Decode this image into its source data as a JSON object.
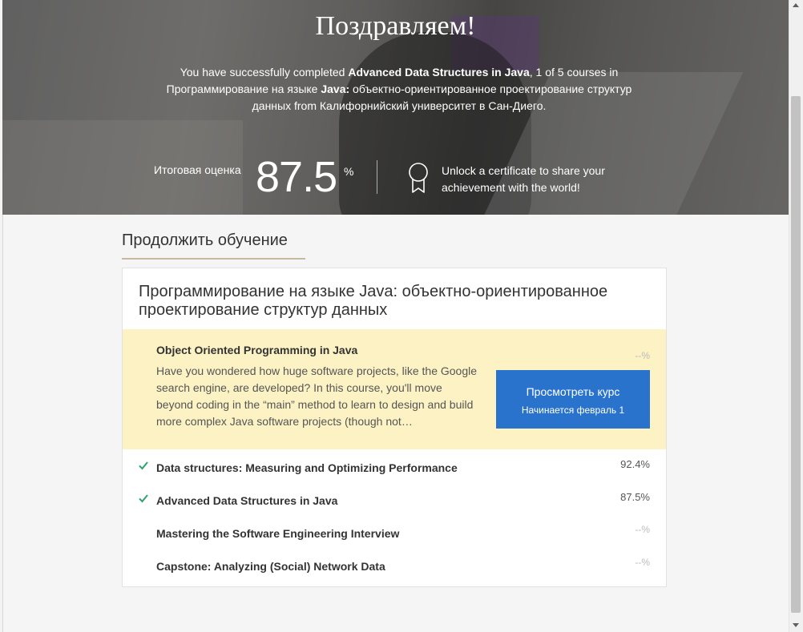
{
  "hero": {
    "title": "Поздравляем!",
    "desc_prefix": "You have successfully completed ",
    "completed_course": "Advanced Data Structures in Java",
    "desc_middle": ", 1 of 5 courses in Программирование на языке ",
    "specialization_bold": "Java:",
    "desc_suffix": " объектно-ориентированное проектирование структур данных from Калифорнийский университет в Сан-Диего.",
    "grade_label": "Итоговая оценка",
    "grade_value": "87.5",
    "grade_unit": "%",
    "certificate_text": "Unlock a certificate to share your achievement with the world!"
  },
  "continue": {
    "section_title": "Продолжить обучение",
    "specialization_title": "Программирование на языке Java: объектно-ориентированное проектирование структур данных",
    "current": {
      "title": "Object Oriented Programming in Java",
      "description": "Have you wondered how huge software projects, like the Google search engine, are developed? In this course, you'll move beyond coding in the “main” method to learn to design and build more complex Java software projects (though not…",
      "percent": "--%",
      "button_label": "Просмотреть курс",
      "button_sublabel": "Начинается февраль 1"
    },
    "courses": [
      {
        "name": "Data structures: Measuring and Optimizing Performance",
        "percent": "92.4%",
        "completed": true
      },
      {
        "name": "Advanced Data Structures in Java",
        "percent": "87.5%",
        "completed": true
      },
      {
        "name": "Mastering the Software Engineering Interview",
        "percent": "--%",
        "completed": false
      },
      {
        "name": "Capstone: Analyzing (Social) Network Data",
        "percent": "--%",
        "completed": false
      }
    ]
  },
  "colors": {
    "accent_blue": "#2a73cc",
    "highlight_bg": "#fcf2c4",
    "check_green": "#2ea36b"
  },
  "icons": {
    "certificate": "ribbon-award-icon",
    "completed": "checkmark-icon"
  }
}
